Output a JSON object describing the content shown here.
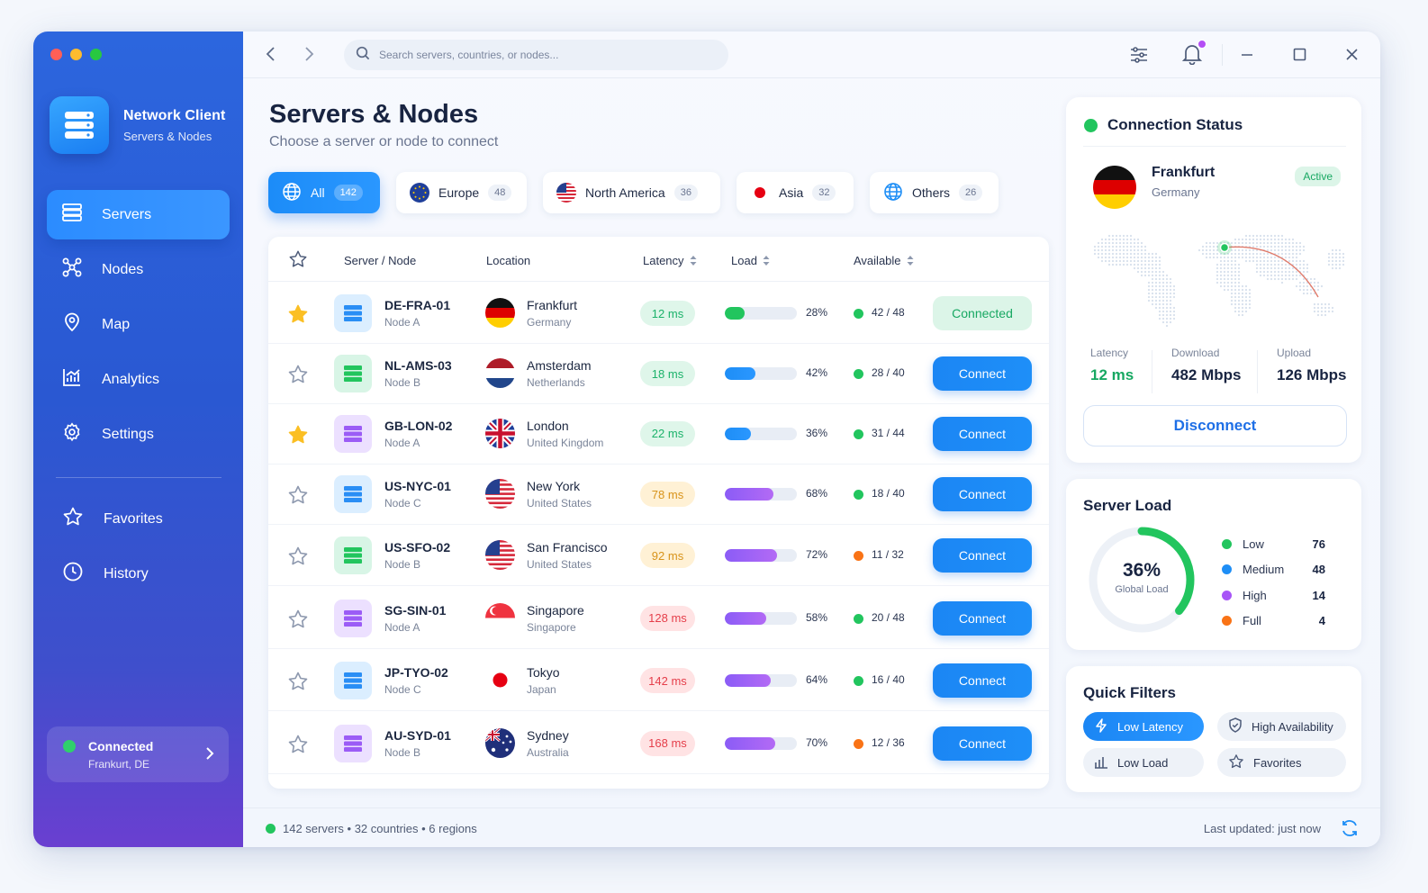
{
  "app": {
    "title": "Network Client",
    "subtitle": "Servers & Nodes"
  },
  "sidebar": {
    "items": [
      {
        "label": "Servers",
        "icon": "server-icon",
        "active": true
      },
      {
        "label": "Nodes",
        "icon": "nodes-icon",
        "active": false
      },
      {
        "label": "Map",
        "icon": "map-pin-icon",
        "active": false
      },
      {
        "label": "Analytics",
        "icon": "analytics-icon",
        "active": false
      },
      {
        "label": "Settings",
        "icon": "gear-icon",
        "active": false
      }
    ],
    "secondary": [
      {
        "label": "Favorites",
        "icon": "star-icon"
      },
      {
        "label": "History",
        "icon": "clock-icon"
      }
    ],
    "status": {
      "label": "Connected",
      "location": "Frankurt, DE"
    }
  },
  "topbar": {
    "search_placeholder": "Search servers, countries, or nodes..."
  },
  "page": {
    "title": "Servers & Nodes",
    "subtitle": "Choose a server or node to connect"
  },
  "filters": [
    {
      "label": "All",
      "count": "142",
      "active": true
    },
    {
      "label": "Europe",
      "count": "48",
      "active": false
    },
    {
      "label": "North America",
      "count": "36",
      "active": false
    },
    {
      "label": "Asia",
      "count": "32",
      "active": false
    },
    {
      "label": "Others",
      "count": "26",
      "active": false
    }
  ],
  "table": {
    "columns": {
      "server": "Server / Node",
      "location": "Location",
      "latency": "Latency",
      "load": "Load",
      "available": "Available"
    },
    "rows": [
      {
        "favorite": true,
        "name": "DE-FRA-01",
        "node": "Node A",
        "city": "Frankfurt",
        "country": "Germany",
        "latency": "12 ms",
        "load": 28,
        "load_label": "28%",
        "available": "42 / 48",
        "action": "Connected",
        "connected": true
      },
      {
        "favorite": false,
        "name": "NL-AMS-03",
        "node": "Node B",
        "city": "Amsterdam",
        "country": "Netherlands",
        "latency": "18 ms",
        "load": 42,
        "load_label": "42%",
        "available": "28 / 40",
        "action": "Connect",
        "connected": false
      },
      {
        "favorite": true,
        "name": "GB-LON-02",
        "node": "Node A",
        "city": "London",
        "country": "United Kingdom",
        "latency": "22 ms",
        "load": 36,
        "load_label": "36%",
        "available": "31 / 44",
        "action": "Connect",
        "connected": false
      },
      {
        "favorite": false,
        "name": "US-NYC-01",
        "node": "Node C",
        "city": "New York",
        "country": "United States",
        "latency": "78 ms",
        "load": 68,
        "load_label": "68%",
        "available": "18 / 40",
        "action": "Connect",
        "connected": false
      },
      {
        "favorite": false,
        "name": "US-SFO-02",
        "node": "Node B",
        "city": "San Francisco",
        "country": "United States",
        "latency": "92 ms",
        "load": 72,
        "load_label": "72%",
        "available": "11 / 32",
        "action": "Connect",
        "connected": false
      },
      {
        "favorite": false,
        "name": "SG-SIN-01",
        "node": "Node A",
        "city": "Singapore",
        "country": "Singapore",
        "latency": "128 ms",
        "load": 58,
        "load_label": "58%",
        "available": "20 / 48",
        "action": "Connect",
        "connected": false
      },
      {
        "favorite": false,
        "name": "JP-TYO-02",
        "node": "Node C",
        "city": "Tokyo",
        "country": "Japan",
        "latency": "142 ms",
        "load": 64,
        "load_label": "64%",
        "available": "16 / 40",
        "action": "Connect",
        "connected": false
      },
      {
        "favorite": false,
        "name": "AU-SYD-01",
        "node": "Node B",
        "city": "Sydney",
        "country": "Australia",
        "latency": "168 ms",
        "load": 70,
        "load_label": "70%",
        "available": "12 / 36",
        "action": "Connect",
        "connected": false
      }
    ]
  },
  "footer": {
    "info": "142 servers  •  32 countries  •  6 regions",
    "updated": "Last updated: just now"
  },
  "connection": {
    "title": "Connection Status",
    "city": "Frankfurt",
    "country": "Germany",
    "badge": "Active",
    "latency_label": "Latency",
    "latency": "12 ms",
    "download_label": "Download",
    "download": "482 Mbps",
    "upload_label": "Upload",
    "upload": "126 Mbps",
    "disconnect": "Disconnect"
  },
  "server_load": {
    "title": "Server Load",
    "percent": "36%",
    "percent_value": 36,
    "label": "Global Load",
    "legend": [
      {
        "label": "Low",
        "value": "76",
        "color": "#22c55e"
      },
      {
        "label": "Medium",
        "value": "48",
        "color": "#1e8ef6"
      },
      {
        "label": "High",
        "value": "14",
        "color": "#a855f7"
      },
      {
        "label": "Full",
        "value": "4",
        "color": "#f97316"
      }
    ]
  },
  "quick_filters": {
    "title": "Quick Filters",
    "items": [
      {
        "label": "Low Latency",
        "icon": "lightning-icon",
        "active": true
      },
      {
        "label": "High Availability",
        "icon": "shield-icon",
        "active": false
      },
      {
        "label": "Low Load",
        "icon": "bars-icon",
        "active": false
      },
      {
        "label": "Favorites",
        "icon": "star-icon",
        "active": false
      }
    ]
  },
  "colors": {
    "accent": "#1e8ef6",
    "success": "#22c55e",
    "warning": "#f97316",
    "danger": "#e53e4a"
  }
}
